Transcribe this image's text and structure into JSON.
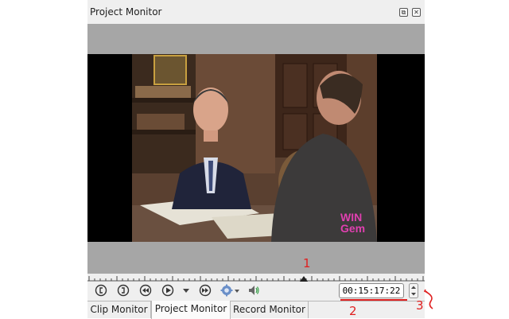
{
  "window": {
    "title": "Project Monitor"
  },
  "overlay": {
    "watermark_line1": "WIN",
    "watermark_line2": "Gem"
  },
  "transport": {
    "buttons": [
      "set-zone-in-icon",
      "set-zone-out-icon",
      "rewind-icon",
      "play-icon",
      "dropdown-arrow-icon",
      "forward-icon",
      "settings-icon",
      "volume-icon"
    ]
  },
  "timecode": {
    "value": "00:15:17:22"
  },
  "tabs": [
    {
      "label": "Clip Monitor",
      "active": false
    },
    {
      "label": "Project Monitor",
      "active": true
    },
    {
      "label": "Record Monitor",
      "active": false
    }
  ],
  "annotations": {
    "one": "1",
    "two": "2",
    "three": "3"
  },
  "colors": {
    "accent": "#e02020",
    "viewer_bg": "#a6a6a6",
    "panel_bg": "#efefef",
    "watermark": "#e040b0"
  }
}
